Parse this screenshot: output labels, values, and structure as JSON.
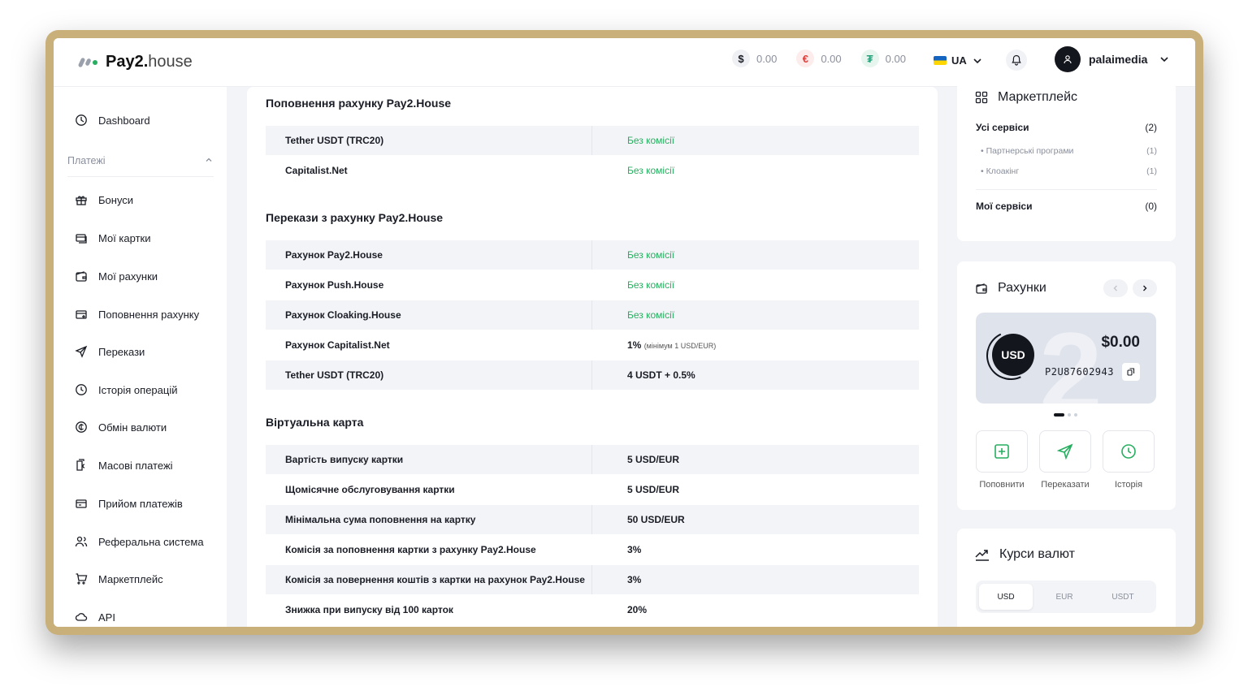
{
  "header": {
    "logo_bold": "Pay2.",
    "logo_light": "house",
    "balances": [
      {
        "symbol": "$",
        "value": "0.00",
        "bg": "#eef0f4",
        "color": "#1a1d26"
      },
      {
        "symbol": "€",
        "value": "0.00",
        "bg": "#fdecec",
        "color": "#e53935"
      },
      {
        "symbol": "₮",
        "value": "0.00",
        "bg": "#e6f6ef",
        "color": "#26a17b"
      }
    ],
    "lang": "UA",
    "username": "palaimedia"
  },
  "sidebar": {
    "dashboard": "Dashboard",
    "section": "Платежі",
    "items": [
      "Бонуси",
      "Мої картки",
      "Мої рахунки",
      "Поповнення рахунку",
      "Перекази",
      "Історія операцій",
      "Обмін валюти",
      "Масові платежі",
      "Прийом платежів",
      "Реферальна система",
      "Маркетплейс",
      "API"
    ]
  },
  "main": {
    "topup": {
      "title": "Поповнення рахунку Pay2.House",
      "rows": [
        {
          "name": "Tether USDT (TRC20)",
          "fee": "Без комісії"
        },
        {
          "name": "Capitalist.Net",
          "fee": "Без комісії"
        }
      ]
    },
    "transfers": {
      "title": "Перекази з рахунку Pay2.House",
      "rows": [
        {
          "name": "Рахунок Pay2.House",
          "fee": "Без комісії"
        },
        {
          "name": "Рахунок Push.House",
          "fee": "Без комісії"
        },
        {
          "name": "Рахунок Cloaking.House",
          "fee": "Без комісії"
        },
        {
          "name": "Рахунок Capitalist.Net",
          "fee": "1%",
          "fee_note": "(мінімум 1 USD/EUR)"
        },
        {
          "name": "Tether USDT (TRC20)",
          "fee": "4 USDT + 0.5%"
        }
      ]
    },
    "virtual_card": {
      "title": "Віртуальна карта",
      "rows": [
        {
          "name": "Вартість випуску картки",
          "fee": "5 USD/EUR"
        },
        {
          "name": "Щомісячне обслуговування картки",
          "fee": "5 USD/EUR"
        },
        {
          "name": "Мінімальна сума поповнення на картку",
          "fee": "50 USD/EUR"
        },
        {
          "name": "Комісія за поповнення картки з рахунку Pay2.House",
          "fee": "3%"
        },
        {
          "name": "Комісія за повернення коштів з картки на рахунок Pay2.House",
          "fee": "3%"
        },
        {
          "name": "Знижка при випуску від 100 карток",
          "fee": "20%"
        }
      ]
    }
  },
  "marketplace": {
    "title": "Маркетплейс",
    "all_label": "Усі сервіси",
    "all_count": "(2)",
    "sub": [
      {
        "label": "Партнерські програми",
        "count": "(1)"
      },
      {
        "label": "Клоакінг",
        "count": "(1)"
      }
    ],
    "mine_label": "Мої сервіси",
    "mine_count": "(0)"
  },
  "accounts": {
    "title": "Рахунки",
    "currency": "USD",
    "amount": "$0.00",
    "account_id": "P2U87602943",
    "actions": [
      "Поповнити",
      "Переказати",
      "Історія"
    ]
  },
  "rates": {
    "title": "Курси валют",
    "tabs": [
      "USD",
      "EUR",
      "USDT"
    ]
  },
  "colors": {
    "accent_green": "#27ae60",
    "dark": "#14161d"
  }
}
